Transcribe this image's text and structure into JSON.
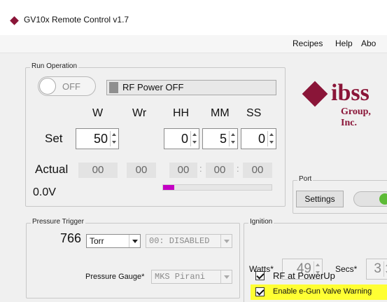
{
  "window": {
    "title": "GV10x Remote Control v1.7"
  },
  "menu": {
    "items": [
      "Recipes",
      "Help",
      "Abo"
    ]
  },
  "run_operation": {
    "group_label": "Run Operation",
    "toggle_label": "OFF",
    "rf_status": "RF Power OFF",
    "columns": {
      "w": "W",
      "wr": "Wr",
      "hh": "HH",
      "mm": "MM",
      "ss": "SS"
    },
    "set_label": "Set",
    "set_values": {
      "w": "50",
      "hh": "0",
      "mm": "5",
      "ss": "0"
    },
    "actual_label": "Actual",
    "actual_values": {
      "w": "00",
      "wr": "00",
      "hh": "00",
      "mm": "00",
      "ss": "00"
    },
    "separator": ":",
    "voltage": "0.0V",
    "progress_fraction": 0.1
  },
  "logo": {
    "word": "ibss",
    "sub": "Group, Inc."
  },
  "port": {
    "group_label": "Port",
    "settings_button": "Settings",
    "toggle_on": true
  },
  "pressure_trigger": {
    "group_label": "Pressure Trigger",
    "value": "766",
    "unit": "Torr",
    "mode": "00: DISABLED",
    "gauge_label": "Pressure Gauge*",
    "gauge_value": "MKS Pirani"
  },
  "ignition": {
    "group_label": "Ignition",
    "watts_label": "Watts*",
    "watts_value": "49",
    "secs_label": "Secs*",
    "secs_value": "3",
    "rf_powerup_label": "RF at PowerUp",
    "egun_label": "Enable e-Gun Valve Warning"
  },
  "colors": {
    "brand": "#8a1538",
    "progress": "#c400c4",
    "toggle_on": "#5dbb37",
    "highlight": "#ffff33"
  }
}
